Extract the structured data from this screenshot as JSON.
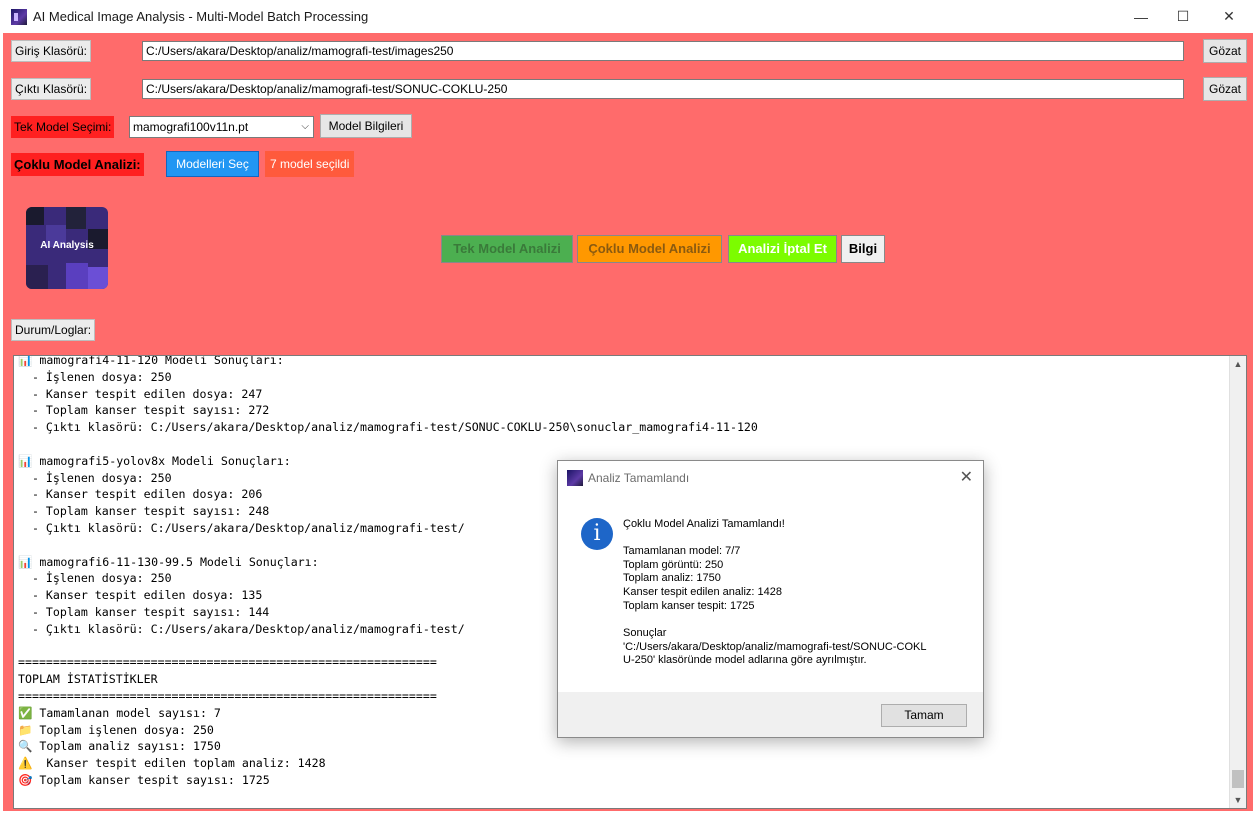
{
  "window": {
    "title": "AI Medical Image Analysis - Multi-Model Batch Processing",
    "minimize": "—",
    "maximize": "☐",
    "close": "✕"
  },
  "input_folder": {
    "label": "Giriş Klasörü:",
    "value": "C:/Users/akara/Desktop/analiz/mamografi-test/images250",
    "browse": "Gözat"
  },
  "output_folder": {
    "label": "Çıktı Klasörü:",
    "value": "C:/Users/akara/Desktop/analiz/mamografi-test/SONUC-COKLU-250",
    "browse": "Gözat"
  },
  "single_model": {
    "label": "Tek Model Seçimi:",
    "selected": "mamografi100v11n.pt",
    "info_button": "Model Bilgileri"
  },
  "multi_model": {
    "label": "Çoklu Model Analizi:",
    "select_button": "Modelleri Seç",
    "status": "7 model seçildi"
  },
  "logo": {
    "text": "AI Analysis"
  },
  "actions": {
    "single": "Tek Model Analizi",
    "multi": "Çoklu Model Analizi",
    "cancel": "Analizi İptal Et",
    "info": "Bilgi"
  },
  "colors": {
    "background": "#ff6b6b",
    "single_btn": "#4caf50",
    "multi_btn": "#ff9800",
    "cancel_btn": "#7cfc00",
    "select_btn": "#2196f3",
    "red_label": "#ff2020"
  },
  "log": {
    "label": "Durum/Loglar:",
    "lines": [
      "📊 mamografi4-11-120 Modeli Sonuçları:",
      "  - İşlenen dosya: 250",
      "  - Kanser tespit edilen dosya: 247",
      "  - Toplam kanser tespit sayısı: 272",
      "  - Çıktı klasörü: C:/Users/akara/Desktop/analiz/mamografi-test/SONUC-COKLU-250\\sonuclar_mamografi4-11-120",
      "",
      "📊 mamografi5-yolov8x Modeli Sonuçları:",
      "  - İşlenen dosya: 250",
      "  - Kanser tespit edilen dosya: 206",
      "  - Toplam kanser tespit sayısı: 248",
      "  - Çıktı klasörü: C:/Users/akara/Desktop/analiz/mamografi-test/",
      "",
      "📊 mamografi6-11-130-99.5 Modeli Sonuçları:",
      "  - İşlenen dosya: 250",
      "  - Kanser tespit edilen dosya: 135",
      "  - Toplam kanser tespit sayısı: 144",
      "  - Çıktı klasörü: C:/Users/akara/Desktop/analiz/mamografi-test/",
      "",
      "============================================================",
      "TOPLAM İSTATİSTİKLER",
      "============================================================",
      "✅ Tamamlanan model sayısı: 7",
      "📁 Toplam işlenen dosya: 250",
      "🔍 Toplam analiz sayısı: 1750",
      "⚠️  Kanser tespit edilen toplam analiz: 1428",
      "🎯 Toplam kanser tespit sayısı: 1725"
    ]
  },
  "dialog": {
    "title": "Analiz Tamamlandı",
    "heading": "Çoklu Model Analizi Tamamlandı!",
    "stats": "Tamamlanan model: 7/7\nToplam görüntü: 250\nToplam analiz: 1750\nKanser tespit edilen analiz: 1428\nToplam kanser tespit: 1725",
    "results": "Sonuçlar\n'C:/Users/akara/Desktop/analiz/mamografi-test/SONUC-COKL\nU-250' klasöründe model adlarına göre ayrılmıştır.",
    "ok": "Tamam"
  }
}
